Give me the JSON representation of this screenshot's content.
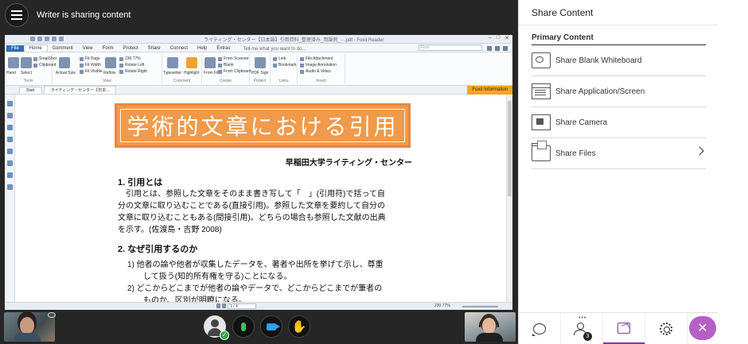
{
  "session": {
    "status_text": "Writer is sharing content"
  },
  "foxit": {
    "window_title": "ライティング・センター【日本語】引用資料_整理済み_用語例_ - .pdf - Foxit Reader",
    "tabs": [
      "File",
      "Home",
      "Comment",
      "View",
      "Form",
      "Protect",
      "Share",
      "Connect",
      "Help",
      "Extras"
    ],
    "active_tab": "Home",
    "tell_me": "Tell me what you want to do...",
    "find_placeholder": "Find",
    "ribbon": {
      "groups": [
        "Tools",
        "View",
        "Comment",
        "Create",
        "Protect",
        "Links",
        "Insert"
      ],
      "hand": "Hand",
      "select": "Select",
      "snapshot": "SnapShot",
      "clipboard": "Clipboard",
      "actual_size": "Actual Size",
      "fit_page": "Fit Page",
      "fit_width": "Fit Width",
      "fit_visible": "Fit Visible",
      "reflow": "Reflow",
      "zoom": "230.77%",
      "rotate_left": "Rotate Left",
      "rotate_right": "Rotate Right",
      "typewriter": "Typewriter",
      "highlight": "Highlight",
      "from_file": "From File",
      "from_scanner": "From Scanner",
      "blank": "Blank",
      "from_clipboard": "From Clipboard",
      "pdf_sign": "PDF Sign",
      "link": "Link",
      "bookmark": "Bookmark",
      "file_attachment": "File Attachment",
      "image_annotation": "Image Annotation",
      "audio_video": "Audio & Video"
    },
    "doc_tabs": [
      "Start",
      "ライティング・センター【日本..."
    ],
    "foxit_information": "Foxit Information",
    "page_field": "1 / 4",
    "zoom_status": "230.77%"
  },
  "document": {
    "banner": "学術的文章における引用",
    "author": "早稲田大学ライティング・センター",
    "h1": "1.  引用とは",
    "p1_lines": [
      "　引用とは、参照した文章をそのまま書き写して「　」(引用符)で括って自",
      "分の文章に取り込むことである(直接引用)。参照した文章を要約して自分の",
      "文章に取り込むこともある(間接引用)。どちらの場合も参照した文献の出典",
      "を示す。(佐渡島・吉野 2008)"
    ],
    "h2": "2.  なぜ引用するのか",
    "list_lines": [
      "1) 他者の論や他者が収集したデータを、著者や出所を挙げて示し、尊重",
      "　　して扱う(知的所有権を守る)ことになる。",
      "2) どこからどこまでが他者の論やデータで、どこからどこまでが筆者の",
      "　　ものか、区別が明瞭になる。"
    ]
  },
  "panel": {
    "title": "Share Content",
    "section": "Primary Content",
    "options": [
      {
        "label": "Share Blank Whiteboard",
        "icon": "whiteboard-icon"
      },
      {
        "label": "Share Application/Screen",
        "icon": "screen-icon"
      },
      {
        "label": "Share Camera",
        "icon": "camera-icon"
      },
      {
        "label": "Share Files",
        "icon": "files-icon"
      }
    ],
    "attendee_count": "3"
  },
  "colors": {
    "accent": "#7b3fa0",
    "close_button": "#b55fc7",
    "banner_orange": "#f09a4a",
    "foxit_info": "#f5a623",
    "mic_green": "#3ec35a",
    "camera_blue": "#2f9ef5"
  }
}
